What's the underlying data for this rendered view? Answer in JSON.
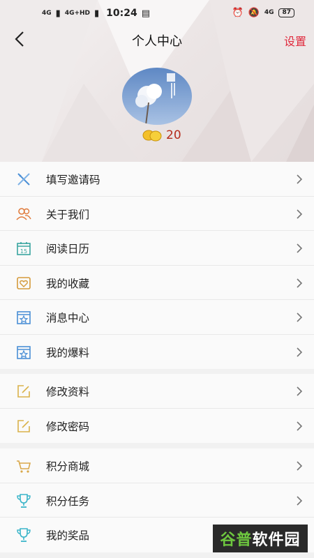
{
  "status": {
    "signal1": "4G",
    "signal2": "4G+HD",
    "time": "10:24",
    "net": "4G",
    "battery": "87"
  },
  "navbar": {
    "title": "个人中心",
    "action": "设置"
  },
  "profile": {
    "coins": "20"
  },
  "groups": [
    [
      {
        "label": "填写邀请码",
        "icon": "pencil-ruler-icon"
      },
      {
        "label": "关于我们",
        "icon": "people-icon"
      },
      {
        "label": "阅读日历",
        "icon": "calendar-icon"
      },
      {
        "label": "我的收藏",
        "icon": "heart-icon"
      },
      {
        "label": "消息中心",
        "icon": "star-box-icon"
      },
      {
        "label": "我的爆料",
        "icon": "star-box-icon"
      }
    ],
    [
      {
        "label": "修改资料",
        "icon": "edit-icon"
      },
      {
        "label": "修改密码",
        "icon": "edit-icon"
      }
    ],
    [
      {
        "label": "积分商城",
        "icon": "cart-icon"
      },
      {
        "label": "积分任务",
        "icon": "trophy-icon"
      },
      {
        "label": "我的奖品",
        "icon": "trophy-icon"
      }
    ]
  ],
  "watermark": {
    "part1": "谷普",
    "part2": "软件园"
  },
  "colors": {
    "accent": "#e0293c",
    "coin": "#b52a1c",
    "watermark_green": "#6ec73f"
  }
}
